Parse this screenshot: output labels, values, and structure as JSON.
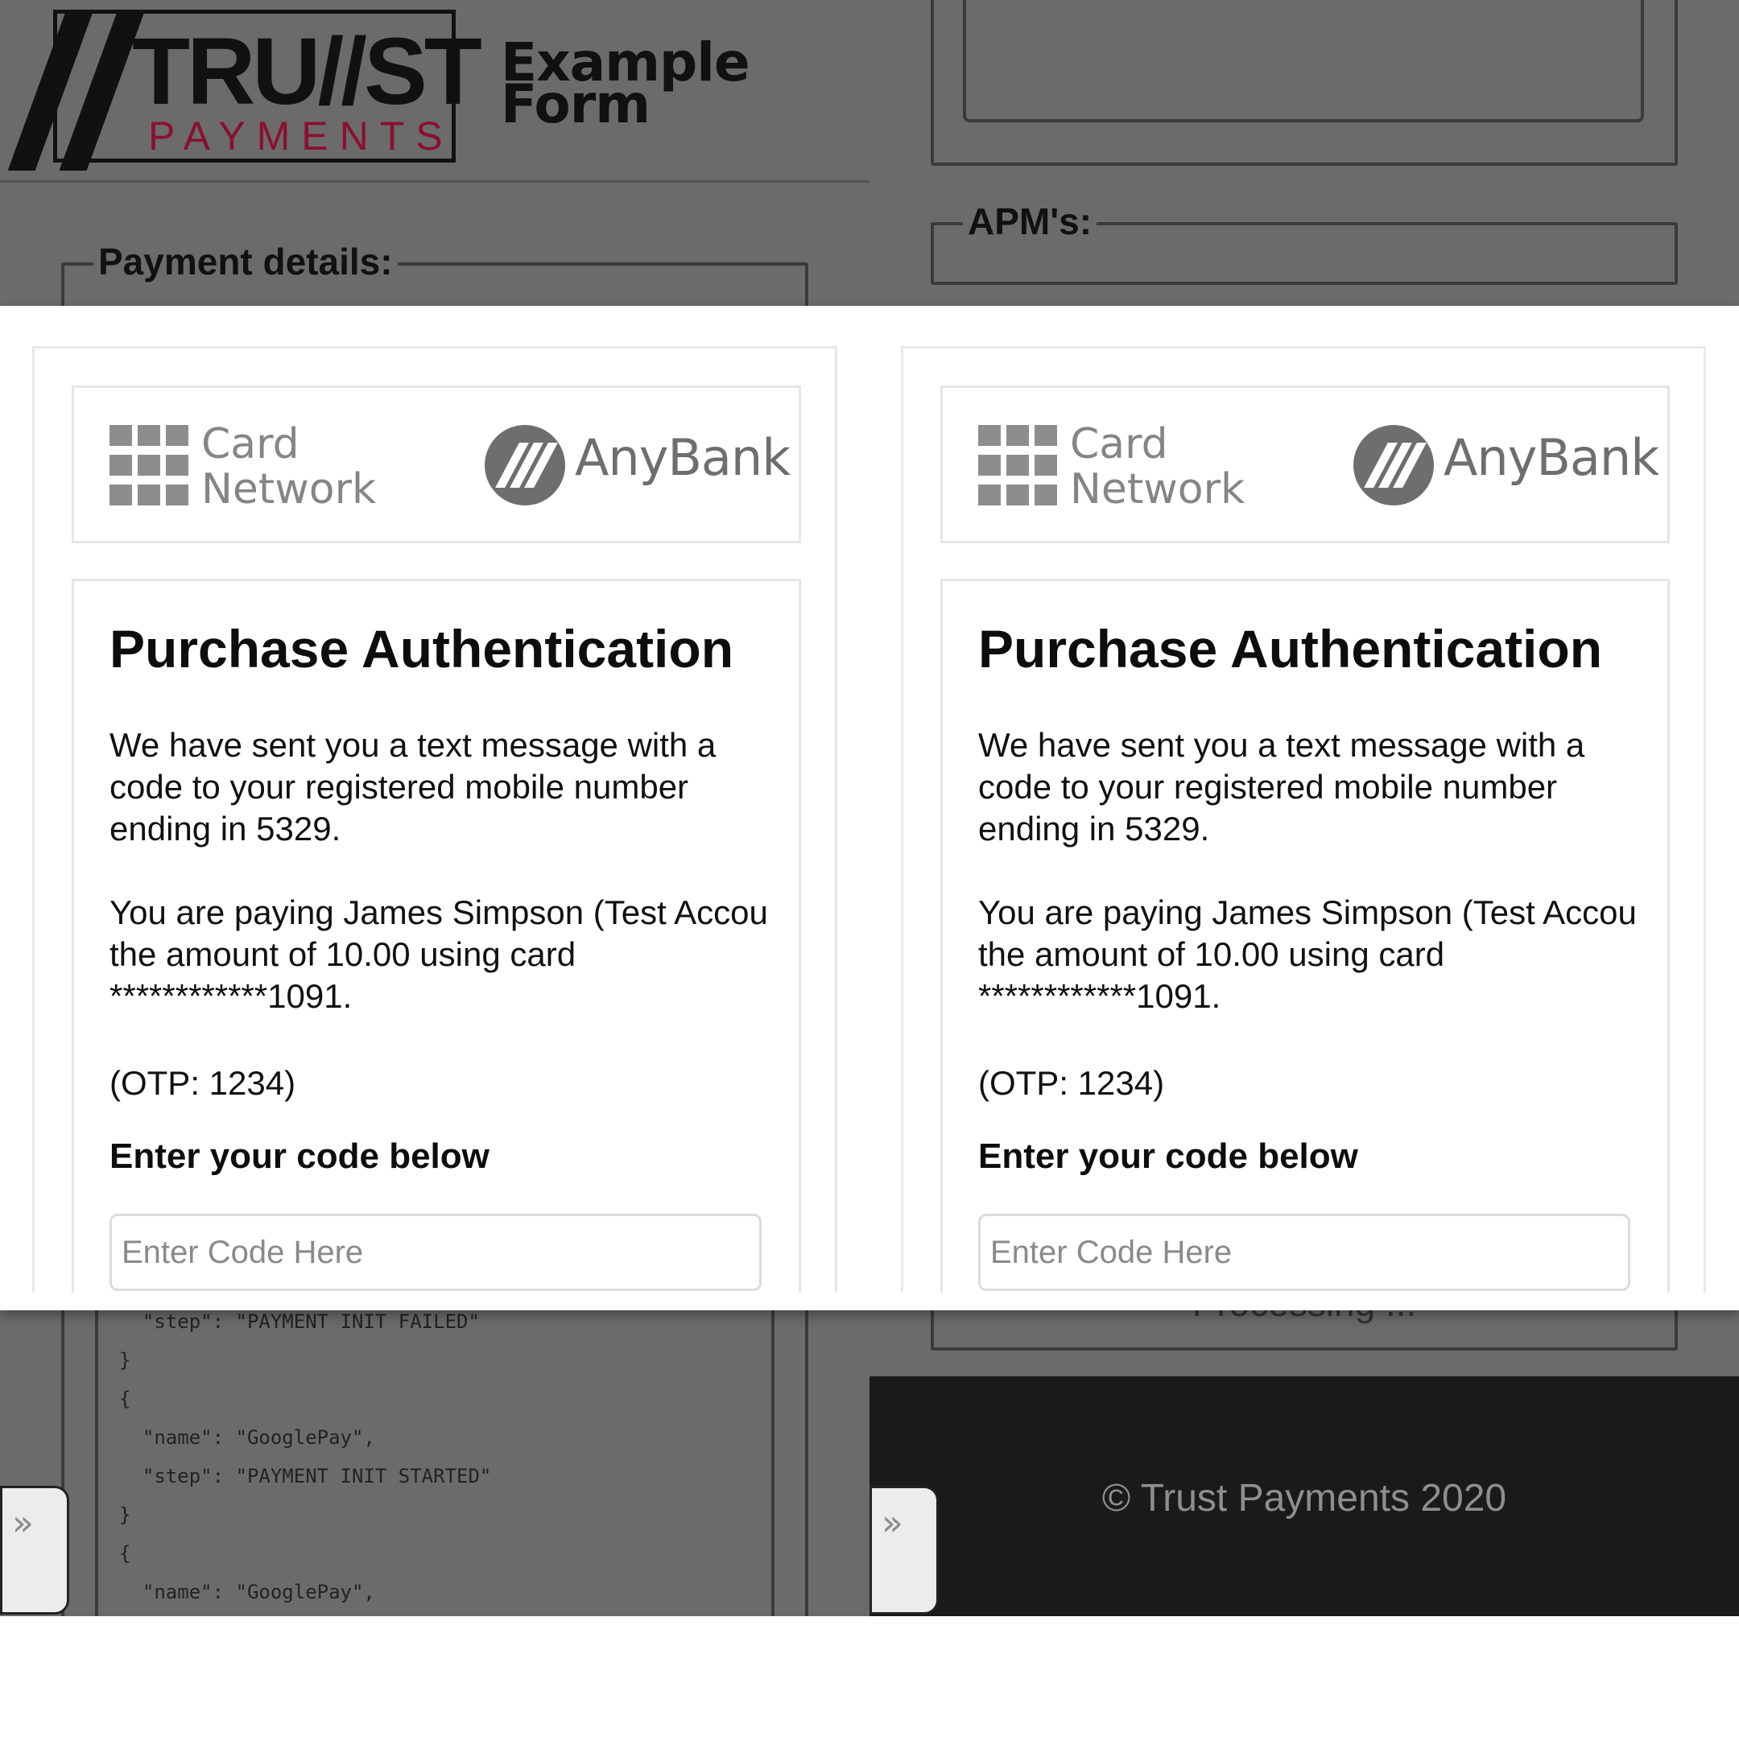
{
  "background_page": {
    "logo": {
      "brand_top": "TRU//ST",
      "brand_bottom": "PAYMENTS",
      "brand_color": "#8a1030"
    },
    "example_form_title": "Example Form",
    "payment_details_legend": "Payment details:",
    "apms_legend": "APM's:",
    "processing_text": "Processing ...",
    "code_lines": [
      "  \"step\": \"PAYMENT INIT FAILED\"",
      "}",
      "{",
      "  \"name\": \"GooglePay\",",
      "  \"step\": \"PAYMENT INIT STARTED\"",
      "}",
      "{",
      "  \"name\": \"GooglePay\","
    ],
    "side_tab_glyph": "»",
    "footer_text": "© Trust Payments 2020"
  },
  "modal": {
    "card_network_line1": "Card",
    "card_network_line2": "Network",
    "bank_name": "AnyBank",
    "title": "Purchase Authentication",
    "message_sent": "We have sent you a text message with a code to your registered mobile number ending in 5329.",
    "payment_info": "You are paying James Simpson (Test Accou the amount of 10.00 using card ************1091.",
    "otp_hint": "(OTP: 1234)",
    "enter_code_label": "Enter your code below",
    "code_placeholder": "Enter Code Here"
  },
  "colors": {
    "overlay_gray": "#6b6b6b",
    "footer_bg": "#1a1a1a",
    "icon_gray": "#8d8d8d"
  }
}
